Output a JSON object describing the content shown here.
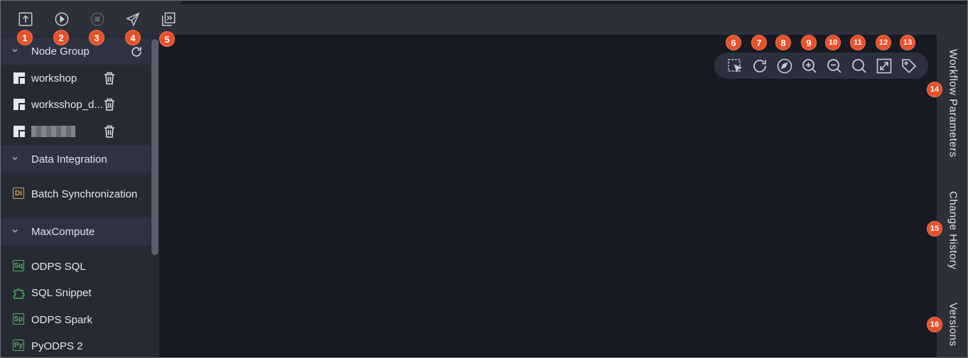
{
  "toolbar": {
    "buttons": [
      {
        "name": "submit",
        "icon": "upload-icon",
        "badge": "1"
      },
      {
        "name": "run",
        "icon": "play-icon",
        "badge": "2"
      },
      {
        "name": "stop",
        "icon": "stop-icon",
        "badge": "3"
      },
      {
        "name": "deploy",
        "icon": "send-icon",
        "badge": "4"
      },
      {
        "name": "go-to-operation-center",
        "icon": "jump-icon",
        "badge": "5"
      }
    ]
  },
  "sidebar": {
    "groups": [
      {
        "title": "Node Group",
        "items": [
          {
            "label": "workshop",
            "icon": "node-group-icon"
          },
          {
            "label": "worksshop_d...",
            "icon": "node-group-icon"
          },
          {
            "label": "",
            "icon": "node-group-icon",
            "redacted": true
          }
        ]
      },
      {
        "title": "Data Integration",
        "items": [
          {
            "label": "Batch Synchronization",
            "tag": "Di",
            "color": "#e0a43a"
          }
        ]
      },
      {
        "title": "MaxCompute",
        "items": [
          {
            "label": "ODPS SQL",
            "tag": "Sq",
            "color": "#4fb45a"
          },
          {
            "label": "SQL Snippet",
            "icon": "puzzle-icon",
            "color": "#4fb45a"
          },
          {
            "label": "ODPS Spark",
            "tag": "Sp",
            "color": "#4fb45a"
          },
          {
            "label": "PyODPS 2",
            "tag": "Py",
            "color": "#4fb45a"
          }
        ]
      }
    ]
  },
  "canvas_toolbar": {
    "buttons": [
      {
        "name": "box-select",
        "icon": "box-select-icon",
        "badge": "6"
      },
      {
        "name": "refresh",
        "icon": "refresh-icon",
        "badge": "7"
      },
      {
        "name": "auto-layout",
        "icon": "layout-icon",
        "badge": "8"
      },
      {
        "name": "zoom-in",
        "icon": "zoom-in-icon",
        "badge": "9"
      },
      {
        "name": "zoom-out",
        "icon": "zoom-out-icon",
        "badge": "10"
      },
      {
        "name": "search",
        "icon": "search-icon",
        "badge": "11"
      },
      {
        "name": "fullscreen",
        "icon": "fullscreen-icon",
        "badge": "12"
      },
      {
        "name": "tag",
        "icon": "tag-icon",
        "badge": "13"
      }
    ]
  },
  "right_panel": {
    "tabs": [
      {
        "label": "Workflow Parameters",
        "badge": "14"
      },
      {
        "label": "Change History",
        "badge": "15"
      },
      {
        "label": "Versions",
        "badge": "16"
      }
    ]
  },
  "colors": {
    "accent_badge": "#e8502a",
    "toolbar_bg": "#2d303b",
    "sidebar_bg": "#262a35",
    "canvas_bg": "#171923",
    "di_tag": "#e0a43a",
    "maxcompute_tag": "#4fb45a"
  }
}
